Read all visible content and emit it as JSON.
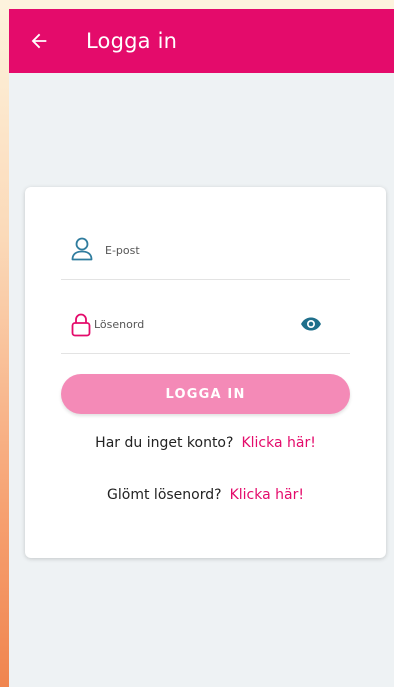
{
  "appbar": {
    "title": "Logga in",
    "back_icon": "arrow-left-icon",
    "color": "#e40b6b"
  },
  "form": {
    "email_placeholder": "E-post",
    "email_value": "",
    "password_placeholder": "Lösenord",
    "password_value": "",
    "login_label": "LOGGA IN",
    "login_color": "#f48ab7"
  },
  "links": {
    "no_account_text": "Har du inget konto?",
    "no_account_link": "Klicka här!",
    "forgot_text": "Glömt lösenord?",
    "forgot_link": "Klicka här!",
    "link_color": "#e40b6b"
  },
  "icons": {
    "email": "person-icon",
    "password": "lock-icon",
    "toggle": "eye-icon"
  }
}
